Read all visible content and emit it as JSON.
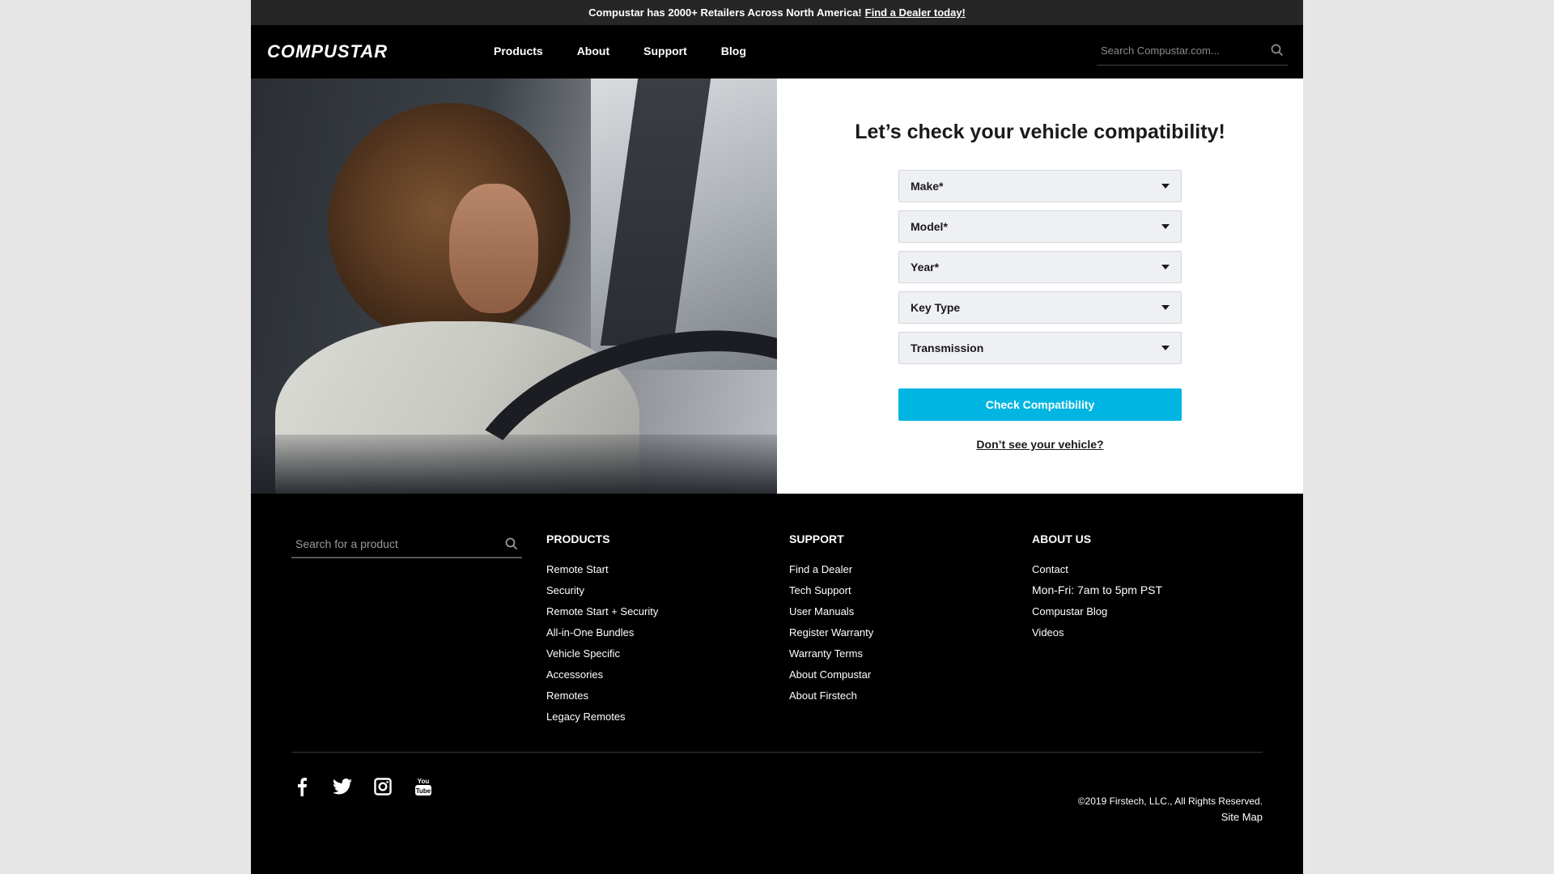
{
  "announcement": {
    "text": "Compustar has 2000+ Retailers Across North America!",
    "link": "Find a Dealer today!"
  },
  "header": {
    "logo": "COMPUSTAR",
    "nav": [
      "Products",
      "About",
      "Support",
      "Blog"
    ],
    "search_placeholder": "Search Compustar.com..."
  },
  "form": {
    "title": "Let’s check your vehicle compatibility!",
    "selects": [
      "Make*",
      "Model*",
      "Year*",
      "Key Type",
      "Transmission"
    ],
    "button": "Check Compatibility",
    "link": "Don’t see your vehicle?"
  },
  "footer": {
    "search_placeholder": "Search for a product",
    "products": {
      "heading": "PRODUCTS",
      "items": [
        "Remote Start",
        "Security",
        "Remote Start + Security",
        "All-in-One Bundles",
        "Vehicle Specific",
        "Accessories",
        "Remotes",
        "Legacy Remotes"
      ]
    },
    "support": {
      "heading": "SUPPORT",
      "items": [
        "Find a Dealer",
        "Tech Support",
        "User Manuals",
        "Register Warranty",
        "Warranty Terms",
        "About Compustar",
        "About Firstech"
      ]
    },
    "about": {
      "heading": "ABOUT US",
      "contact": "Contact",
      "hours": "Mon-Fri: 7am to 5pm PST",
      "blog": "Compustar Blog",
      "videos": "Videos"
    },
    "socials": [
      "facebook-icon",
      "twitter-icon",
      "instagram-icon",
      "youtube-icon"
    ],
    "copyright": "©2019 Firstech, LLC., All Rights Reserved.",
    "sitemap": "Site Map"
  },
  "colors": {
    "accent": "#00b5e2",
    "background": "#000000",
    "page_bg": "#e6e6e6"
  }
}
